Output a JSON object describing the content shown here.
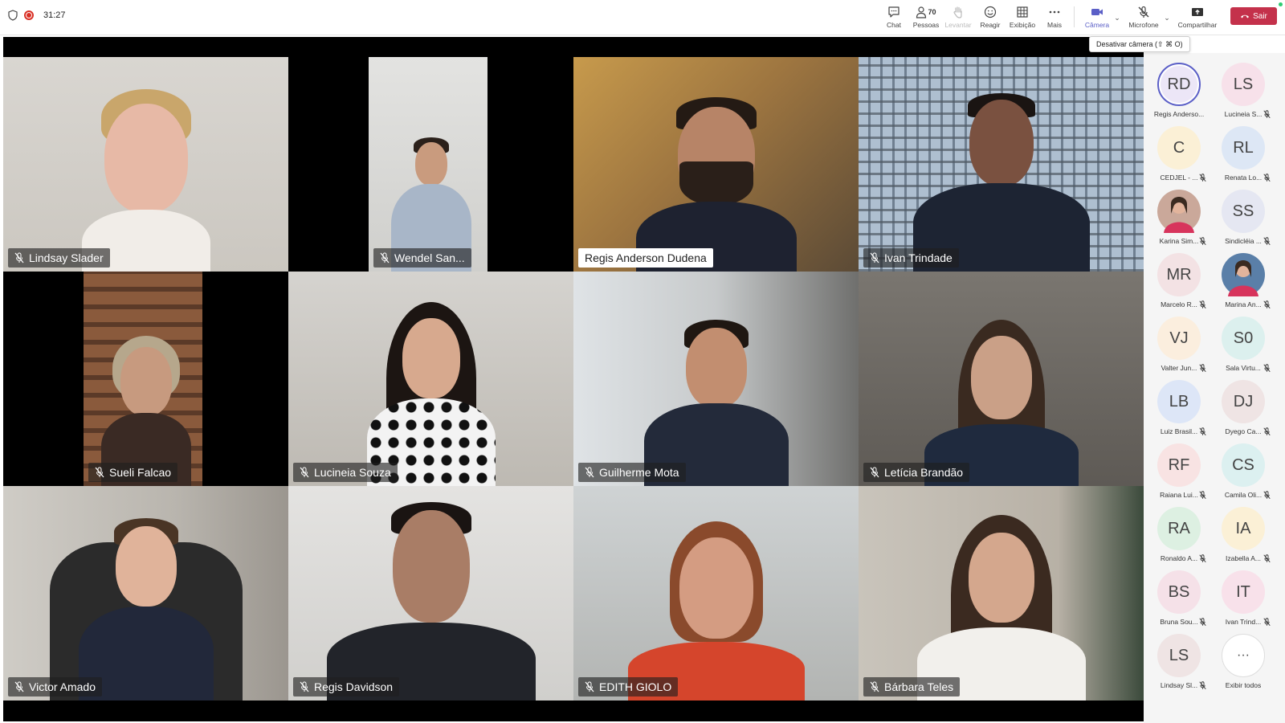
{
  "meeting": {
    "timer": "31:27"
  },
  "toolbar": {
    "chat": "Chat",
    "people": "Pessoas",
    "people_count": "70",
    "raise": "Levantar",
    "react": "Reagir",
    "view": "Exibição",
    "more": "Mais",
    "camera": "Câmera",
    "mic": "Microfone",
    "share": "Compartilhar",
    "leave": "Sair"
  },
  "tooltip": "Desativar câmera (⇧ ⌘ O)",
  "video_tiles": [
    {
      "name": "Lindsay Slader"
    },
    {
      "name": "Wendel San..."
    },
    {
      "name": "Regis Anderson Dudena"
    },
    {
      "name": "Ivan Trindade"
    },
    {
      "name": "Sueli Falcao"
    },
    {
      "name": "Lucineia Souza"
    },
    {
      "name": "Guilherme Mota"
    },
    {
      "name": "Letícia Brandão"
    },
    {
      "name": "Victor Amado"
    },
    {
      "name": "Regis Davidson"
    },
    {
      "name": "EDITH GIOLO"
    },
    {
      "name": "Bárbara Teles"
    }
  ],
  "participants": [
    {
      "initials": "RD",
      "name": "Regis Anderso...",
      "bg": "#ece6f7",
      "active": true,
      "mic": false
    },
    {
      "initials": "LS",
      "name": "Lucineia S...",
      "bg": "#f7e1ea",
      "mic": true
    },
    {
      "initials": "C",
      "name": "CEDJEL - ...",
      "bg": "#fbf0d6",
      "mic": true
    },
    {
      "initials": "RL",
      "name": "Renata Lo...",
      "bg": "#dde7f5",
      "mic": true
    },
    {
      "initials": "",
      "name": "Karina Sim...",
      "bg": "#caa89a",
      "photo": true,
      "mic": true
    },
    {
      "initials": "SS",
      "name": "Sindicléia ...",
      "bg": "#e5e7f2",
      "mic": true
    },
    {
      "initials": "MR",
      "name": "Marcelo R...",
      "bg": "#f3e2e4",
      "mic": true
    },
    {
      "initials": "",
      "name": "Marina An...",
      "bg": "#5a7fa8",
      "photo": true,
      "mic": true
    },
    {
      "initials": "VJ",
      "name": "Valter Jun...",
      "bg": "#fbeede",
      "mic": true
    },
    {
      "initials": "S0",
      "name": "Sala Virtu...",
      "bg": "#dcf0ee",
      "mic": true
    },
    {
      "initials": "LB",
      "name": "Luiz Brasil...",
      "bg": "#dde6f7",
      "mic": true
    },
    {
      "initials": "DJ",
      "name": "Dyego Ca...",
      "bg": "#efe4e4",
      "mic": true
    },
    {
      "initials": "RF",
      "name": "Raiana Lui...",
      "bg": "#f8e3e3",
      "mic": true
    },
    {
      "initials": "CS",
      "name": "Camila Oli...",
      "bg": "#dcf0f0",
      "mic": true
    },
    {
      "initials": "RA",
      "name": "Ronaldo A...",
      "bg": "#ddf0e2",
      "mic": true
    },
    {
      "initials": "IA",
      "name": "Izabella A...",
      "bg": "#fbf0d6",
      "mic": true
    },
    {
      "initials": "BS",
      "name": "Bruna Sou...",
      "bg": "#f5e1e8",
      "mic": true
    },
    {
      "initials": "IT",
      "name": "Ivan Trind...",
      "bg": "#f8e1ea",
      "mic": true
    },
    {
      "initials": "LS",
      "name": "Lindsay Sl...",
      "bg": "#efe4e4",
      "mic": true
    },
    {
      "initials": "···",
      "name": "Exibir todos",
      "bg": "#ffffff",
      "more": true,
      "mic": false
    }
  ],
  "colors": {
    "accent": "#5b5fc7",
    "leave": "#c4314b",
    "stage": "#000000",
    "sidebar": "#f5f5f5"
  }
}
